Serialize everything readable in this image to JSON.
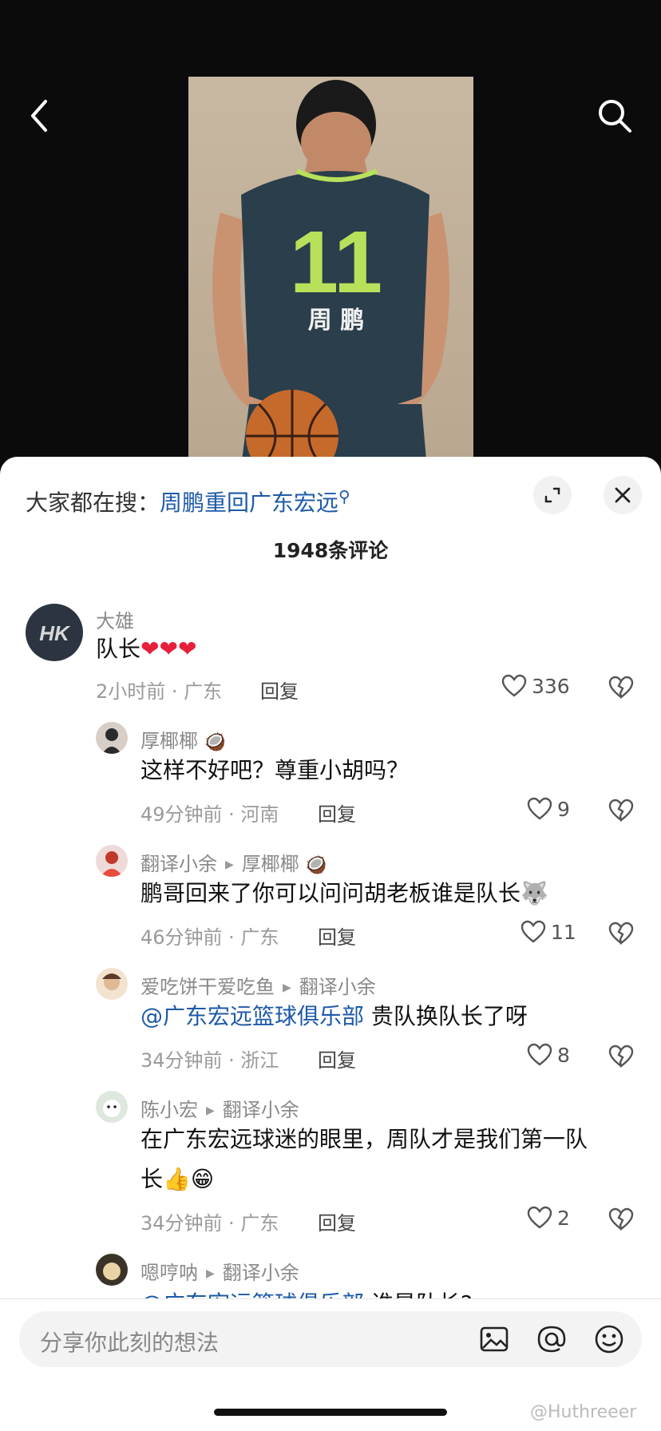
{
  "header": {
    "back_icon": "chevron-left-icon",
    "search_icon": "search-icon"
  },
  "photo": {
    "jersey_number": "11",
    "jersey_name": "周 鹏"
  },
  "hot_search": {
    "prefix": "大家都在搜：",
    "keyword": "周鹏重回广东宏远"
  },
  "comment_count": "1948条评论",
  "comments": [
    {
      "user": "大雄",
      "text": "队长",
      "hearts": "❤❤❤",
      "time": "2小时前 · 广东",
      "reply": "回复",
      "likes": "336"
    },
    {
      "user": "厚椰椰",
      "badge": "🥥",
      "text": "这样不好吧？尊重小胡吗？",
      "time": "49分钟前 · 河南",
      "reply": "回复",
      "likes": "9"
    },
    {
      "user": "翻译小余",
      "reply_to": "厚椰椰",
      "badge": "🥥",
      "text": "鹏哥回来了你可以问问胡老板谁是队长",
      "emoji": "🐺",
      "time": "46分钟前 · 广东",
      "reply": "回复",
      "likes": "11"
    },
    {
      "user": "爱吃饼干爱吃鱼",
      "reply_to": "翻译小余",
      "mention": "@广东宏远篮球俱乐部",
      "text": " 贵队换队长了呀",
      "time": "34分钟前 · 浙江",
      "reply": "回复",
      "likes": "8"
    },
    {
      "user": "陈小宏",
      "reply_to": "翻译小余",
      "text_line1": "在广东宏远球迷的眼里，周队才是我们第一队",
      "text_line2": "长",
      "emoji": "👍😁",
      "time": "34分钟前 · 广东",
      "reply": "回复",
      "likes": "2"
    },
    {
      "user": "嗯哼呐",
      "reply_to": "翻译小余",
      "mention": "@广东宏远篮球俱乐部",
      "text": " 谁是队长?"
    }
  ],
  "input": {
    "placeholder": "分享你此刻的想法"
  },
  "watermark": "@Huthreeer",
  "colors": {
    "link": "#1e5aa8",
    "heart": "#e6203a"
  }
}
